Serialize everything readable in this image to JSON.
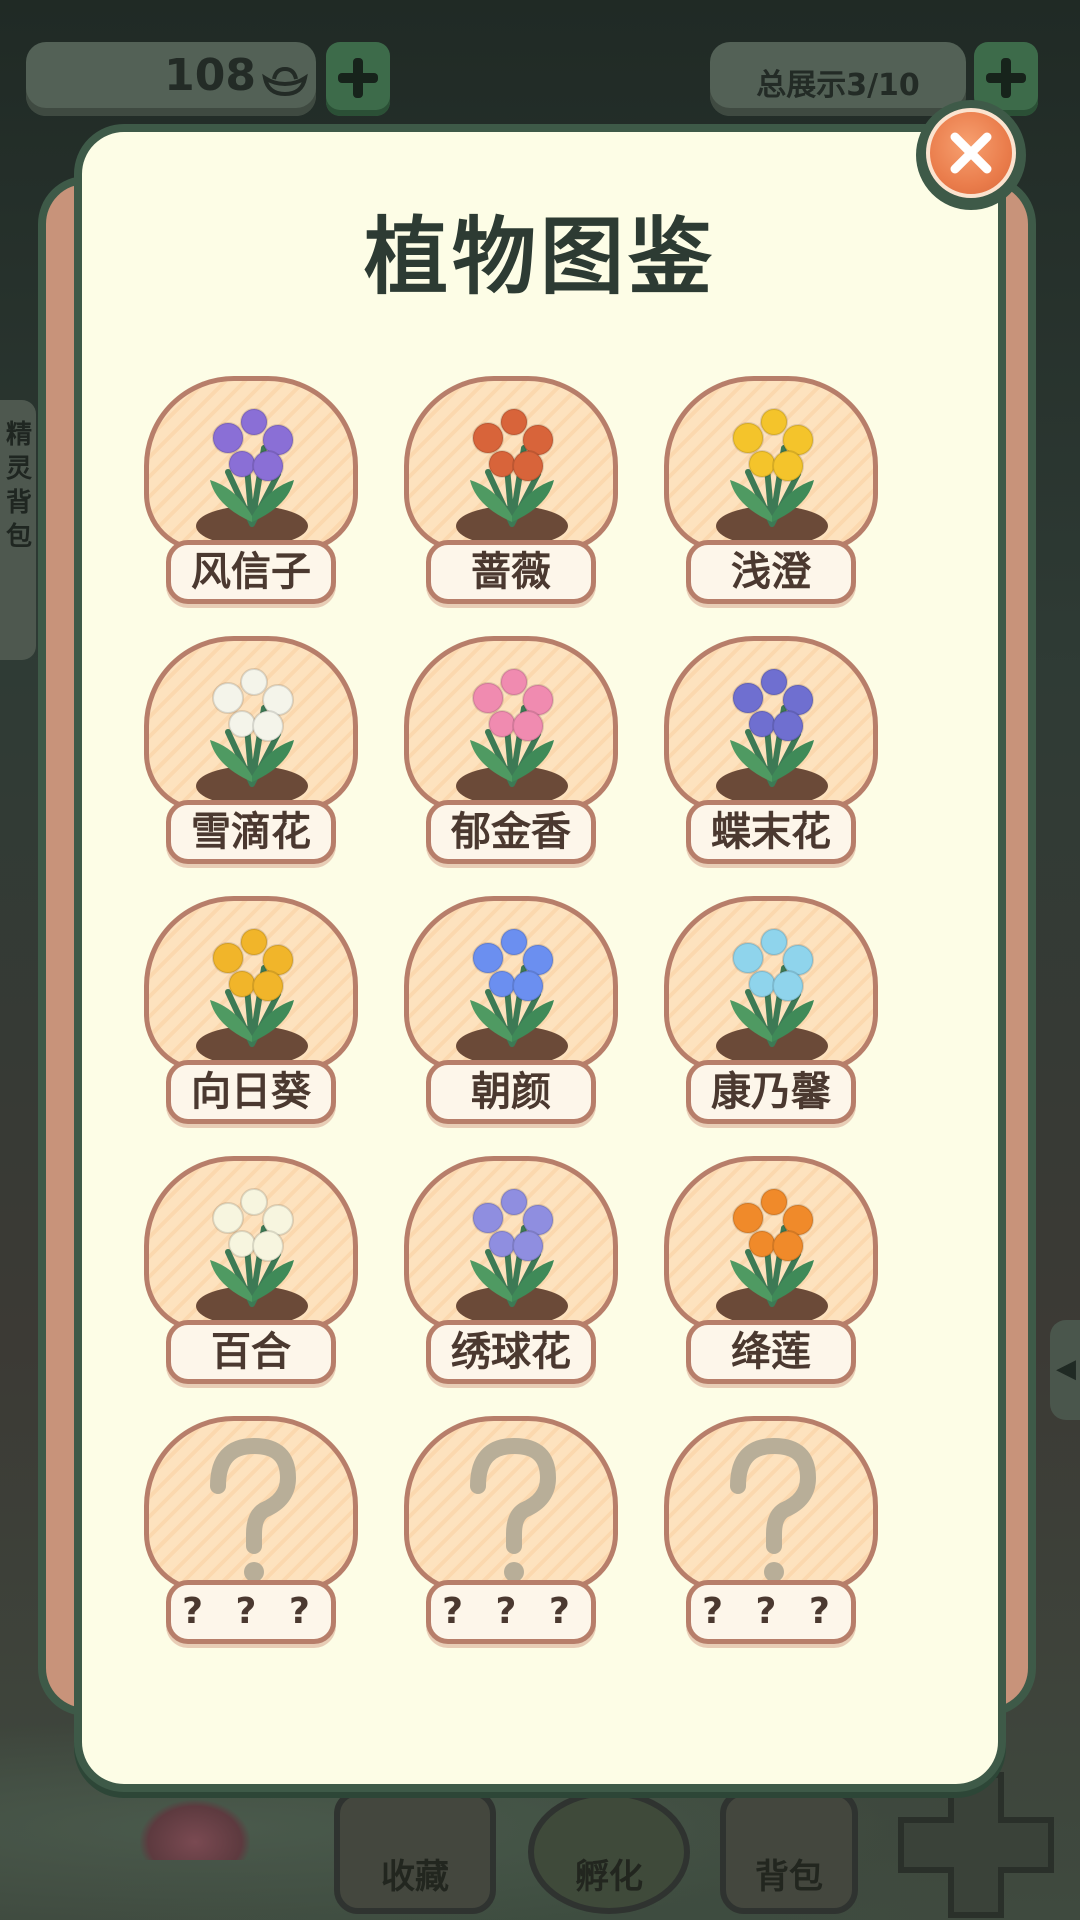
{
  "hud": {
    "currency": "108",
    "total_display": "总展示3/10"
  },
  "side_tab": {
    "label": "精灵背包"
  },
  "modal": {
    "title": "植物图鉴"
  },
  "plants": [
    {
      "name": "风信子",
      "icon": "hyacinth-icon",
      "color": "#8a6fd6"
    },
    {
      "name": "蔷薇",
      "icon": "rose-icon",
      "color": "#d8643a"
    },
    {
      "name": "浅澄",
      "icon": "yellow-flower-icon",
      "color": "#f4c42b"
    },
    {
      "name": "雪滴花",
      "icon": "snowdrop-icon",
      "color": "#f4f4ea"
    },
    {
      "name": "郁金香",
      "icon": "tulip-icon",
      "color": "#f08bb0"
    },
    {
      "name": "蝶末花",
      "icon": "iris-icon",
      "color": "#6f6fd0"
    },
    {
      "name": "向日葵",
      "icon": "sunflower-icon",
      "color": "#f1b52a"
    },
    {
      "name": "朝颜",
      "icon": "morning-glory-icon",
      "color": "#6b8ff0"
    },
    {
      "name": "康乃馨",
      "icon": "carnation-icon",
      "color": "#8fd4ec"
    },
    {
      "name": "百合",
      "icon": "lily-icon",
      "color": "#f7f5df"
    },
    {
      "name": "绣球花",
      "icon": "hydrangea-icon",
      "color": "#8f8ee0"
    },
    {
      "name": "绛莲",
      "icon": "orange-lotus-icon",
      "color": "#f08a2a"
    },
    {
      "name": "? ? ?",
      "icon": "question-mark-icon",
      "color": "#b8ae98"
    },
    {
      "name": "? ? ?",
      "icon": "question-mark-icon",
      "color": "#b8ae98"
    },
    {
      "name": "? ? ?",
      "icon": "question-mark-icon",
      "color": "#b8ae98"
    }
  ],
  "bottom_nav": [
    {
      "label": "收藏",
      "icon": "collection-icon"
    },
    {
      "label": "孵化",
      "icon": "egg-icon"
    },
    {
      "label": "背包",
      "icon": "bag-icon"
    }
  ]
}
